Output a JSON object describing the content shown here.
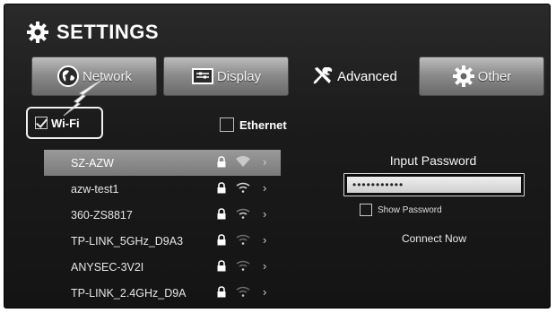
{
  "header": {
    "title": "SETTINGS"
  },
  "tabs": [
    {
      "label": "Network",
      "icon": "globe-icon",
      "active": false
    },
    {
      "label": "Display",
      "icon": "display-icon",
      "active": false
    },
    {
      "label": "Advanced",
      "icon": "tools-icon",
      "active": true
    },
    {
      "label": "Other",
      "icon": "gear-icon",
      "active": false
    }
  ],
  "connection": {
    "wifi_label": "Wi-Fi",
    "wifi_checked": true,
    "ethernet_label": "Ethernet",
    "ethernet_checked": false
  },
  "networks": [
    {
      "name": "SZ-AZW",
      "selected": true
    },
    {
      "name": "azw-test1",
      "selected": false
    },
    {
      "name": "360-ZS8817",
      "selected": false
    },
    {
      "name": "TP-LINK_5GHz_D9A3",
      "selected": false
    },
    {
      "name": "ANYSEC-3V2I",
      "selected": false
    },
    {
      "name": "TP-LINK_2.4GHz_D9A",
      "selected": false
    }
  ],
  "password": {
    "label": "Input Password",
    "value": "•••••••••••",
    "show_password_label": "Show Password",
    "connect_label": "Connect Now"
  },
  "colors": {
    "background": "#1b1b1b",
    "tab_gray": "#8c8c8c",
    "selected_row": "#8a8a8a",
    "text": "#ffffff"
  }
}
